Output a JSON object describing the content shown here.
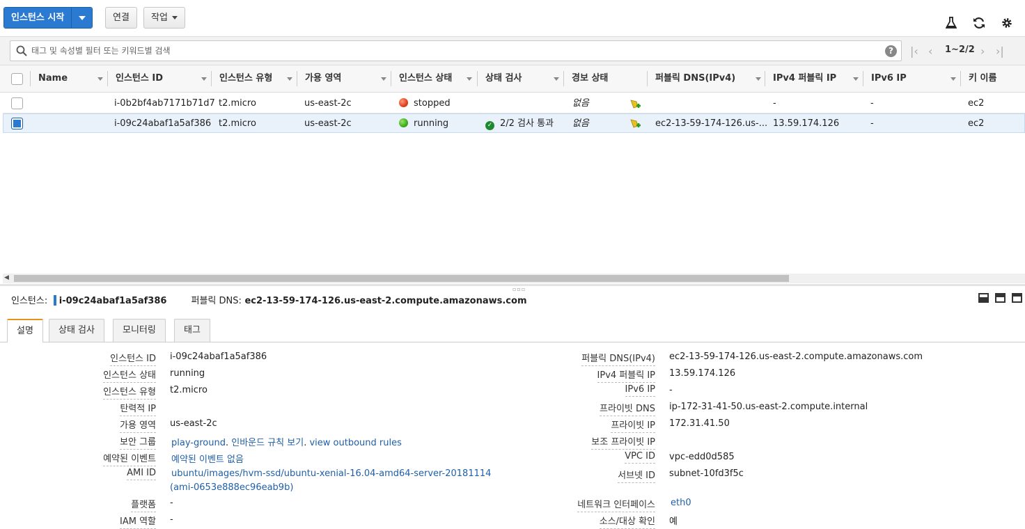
{
  "toolbar": {
    "launch_label": "인스턴스 시작",
    "connect_label": "연결",
    "actions_label": "작업"
  },
  "search": {
    "placeholder": "태그 및 속성별 필터 또는 키워드별 검색",
    "help": "?"
  },
  "pager": {
    "text": "1~2/2"
  },
  "columns": [
    "Name",
    "인스턴스 ID",
    "인스턴스 유형",
    "가용 영역",
    "인스턴스 상태",
    "상태 검사",
    "경보 상태",
    "퍼블릭 DNS(IPv4)",
    "IPv4 퍼블릭 IP",
    "IPv6 IP",
    "키 이름"
  ],
  "rows": [
    {
      "name": "",
      "instance_id": "i-0b2bf4ab7171b71d7",
      "type": "t2.micro",
      "zone": "us-east-2c",
      "state": "stopped",
      "state_color": "#e2401c",
      "status_check": "",
      "alarm": "없음",
      "public_dns": "",
      "public_ip": "-",
      "ipv6": "-",
      "key": "ec2",
      "selected": false
    },
    {
      "name": "",
      "instance_id": "i-09c24abaf1a5af386",
      "type": "t2.micro",
      "zone": "us-east-2c",
      "state": "running",
      "state_color": "#3cae1d",
      "status_check": "2/2 검사 통과",
      "alarm": "없음",
      "public_dns": "ec2-13-59-174-126.us-...",
      "public_ip": "13.59.174.126",
      "ipv6": "-",
      "key": "ec2",
      "selected": true
    }
  ],
  "detail_header": {
    "instance_label": "인스턴스:",
    "instance_id": "i-09c24abaf1a5af386",
    "dns_label": "퍼블릭 DNS:",
    "dns_value": "ec2-13-59-174-126.us-east-2.compute.amazonaws.com"
  },
  "tabs": [
    "설명",
    "상태 검사",
    "모니터링",
    "태그"
  ],
  "details_left": [
    {
      "label": "인스턴스 ID",
      "value": "i-09c24abaf1a5af386"
    },
    {
      "label": "인스턴스 상태",
      "value": "running"
    },
    {
      "label": "인스턴스 유형",
      "value": "t2.micro"
    },
    {
      "label": "탄력적 IP",
      "value": ""
    },
    {
      "label": "가용 영역",
      "value": "us-east-2c"
    },
    {
      "label": "보안 그룹",
      "value": "play-ground",
      "links": [
        "play-ground",
        "인바운드 규칙 보기",
        "view outbound rules"
      ]
    },
    {
      "label": "예약된 이벤트",
      "value": "예약된 이벤트 없음"
    },
    {
      "label": "AMI ID",
      "value": "ubuntu/images/hvm-ssd/ubuntu-xenial-16.04-amd64-server-20181114",
      "value2": "(ami-0653e888ec96eab9b)"
    },
    {
      "label": "플랫폼",
      "value": "-"
    },
    {
      "label": "IAM 역할",
      "value": "-"
    }
  ],
  "details_right": [
    {
      "label": "퍼블릭 DNS(IPv4)",
      "value": "ec2-13-59-174-126.us-east-2.compute.amazonaws.com"
    },
    {
      "label": "IPv4 퍼블릭 IP",
      "value": "13.59.174.126"
    },
    {
      "label": "IPv6 IP",
      "value": "-"
    },
    {
      "label": "프라이빗 DNS",
      "value": "ip-172-31-41-50.us-east-2.compute.internal"
    },
    {
      "label": "프라이빗 IP",
      "value": "172.31.41.50"
    },
    {
      "label": "보조 프라이빗 IP",
      "value": ""
    },
    {
      "label": "VPC ID",
      "value": "vpc-edd0d585"
    },
    {
      "label": "서브넷 ID",
      "value": "subnet-10fd3f5c"
    },
    {
      "label": "네트워크 인터페이스",
      "value": "eth0"
    },
    {
      "label": "소스/대상 확인",
      "value": "예"
    }
  ]
}
